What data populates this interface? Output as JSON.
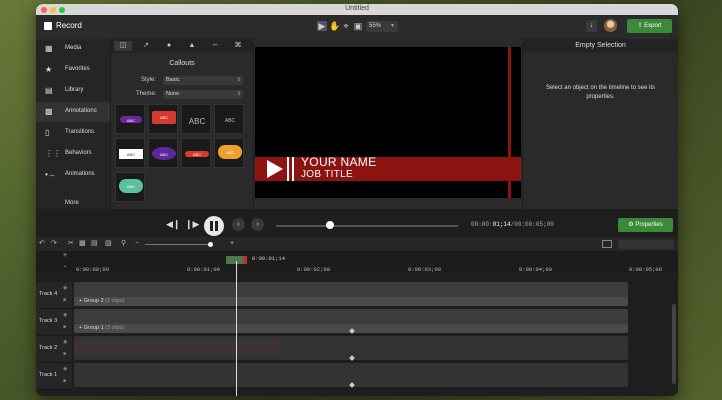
{
  "window": {
    "title": "Untitled"
  },
  "toolbar": {
    "record_label": "Record",
    "zoom": "55%",
    "export_label": "Export"
  },
  "sidebar": {
    "items": [
      {
        "label": "Media",
        "icon": "media-icon"
      },
      {
        "label": "Favorites",
        "icon": "star-icon"
      },
      {
        "label": "Library",
        "icon": "library-icon"
      },
      {
        "label": "Annotations",
        "icon": "annotations-icon"
      },
      {
        "label": "Transitions",
        "icon": "transitions-icon"
      },
      {
        "label": "Behaviors",
        "icon": "behaviors-icon"
      },
      {
        "label": "Animations",
        "icon": "animations-icon"
      }
    ],
    "more_label": "More"
  },
  "callouts": {
    "title": "Callouts",
    "style_label": "Style:",
    "style_value": "Basic",
    "theme_label": "Theme:",
    "theme_value": "None",
    "tile_text": "ABC"
  },
  "preview": {
    "name": "YOUR NAME",
    "job": "JOB TITLE"
  },
  "properties": {
    "header": "Empty Selection",
    "message": "Select an object on the timeline to see its properties.",
    "button_label": "Properties"
  },
  "playback": {
    "timecode_a": "00:00:",
    "timecode_b": "01;14",
    "timecode_c": "/00:00:05;00"
  },
  "timeline": {
    "playhead_time": "0:00:01;14",
    "ticks": [
      "0:00:00;00",
      "0:00:01;00",
      "0:00:02;00",
      "0:00:03;00",
      "0:00:04;00",
      "0:00:05;00"
    ],
    "tracks": [
      "Track 4",
      "Track 3",
      "Track 2",
      "Track 1"
    ],
    "group2": {
      "label": "Group 2",
      "count": "(2 clips)"
    },
    "group1": {
      "label": "Group 1",
      "count": "(3 clips)"
    }
  },
  "colors": {
    "accent_green": "#3a8a3a",
    "title_red": "#8b1410"
  }
}
